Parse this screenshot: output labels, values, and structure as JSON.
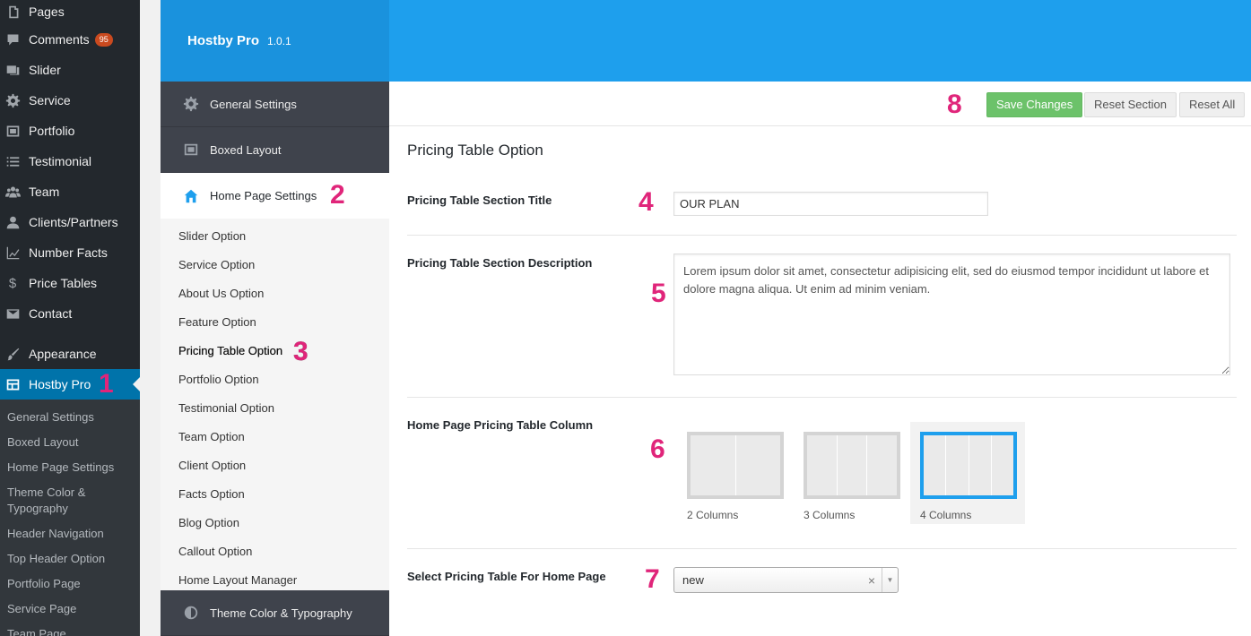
{
  "wp_menu": {
    "items": [
      {
        "label": "Pages",
        "icon": "pages-icon"
      },
      {
        "label": "Comments",
        "icon": "comments-icon",
        "badge": "95"
      },
      {
        "label": "Slider",
        "icon": "slider-icon"
      },
      {
        "label": "Service",
        "icon": "gear-icon"
      },
      {
        "label": "Portfolio",
        "icon": "portfolio-icon"
      },
      {
        "label": "Testimonial",
        "icon": "list-icon"
      },
      {
        "label": "Team",
        "icon": "team-icon"
      },
      {
        "label": "Clients/Partners",
        "icon": "user-icon"
      },
      {
        "label": "Number Facts",
        "icon": "chart-icon"
      },
      {
        "label": "Price Tables",
        "icon": "dollar-icon"
      },
      {
        "label": "Contact",
        "icon": "mail-icon"
      },
      {
        "label": "Appearance",
        "icon": "brush-icon"
      },
      {
        "label": "Hostby Pro",
        "icon": "table-icon",
        "marker": "1"
      }
    ],
    "submenu": [
      "General Settings",
      "Boxed Layout",
      "Home Page Settings",
      "Theme Color & Typography",
      "Header Navigation",
      "Top Header Option",
      "Portfolio Page",
      "Service Page",
      "Team Page"
    ]
  },
  "panel": {
    "brand_name": "Hostby Pro",
    "version": "1.0.1",
    "nav_main": {
      "general": "General Settings",
      "boxed": "Boxed Layout",
      "home": "Home Page Settings",
      "home_marker": "2",
      "theme": "Theme Color & Typography"
    },
    "nav_sub": [
      "Slider Option",
      "Service Option",
      "About Us Option",
      "Feature Option",
      "Pricing Table Option",
      "Portfolio Option",
      "Testimonial Option",
      "Team Option",
      "Client Option",
      "Facts Option",
      "Blog Option",
      "Callout Option",
      "Home Layout Manager"
    ],
    "nav_sub_marker": "3"
  },
  "toolbar": {
    "marker": "8",
    "save": "Save Changes",
    "reset_section": "Reset Section",
    "reset_all": "Reset All"
  },
  "section": {
    "title": "Pricing Table Option",
    "title_field": {
      "label": "Pricing Table Section Title",
      "marker": "4",
      "value": "OUR PLAN"
    },
    "desc_field": {
      "label": "Pricing Table Section Description",
      "marker": "5",
      "value": "Lorem ipsum dolor sit amet, consectetur adipisicing elit, sed do eiusmod tempor incididunt ut labore et dolore magna aliqua. Ut enim ad minim veniam."
    },
    "columns_field": {
      "label": "Home Page Pricing Table Column",
      "marker": "6",
      "options": [
        "2 Columns",
        "3 Columns",
        "4 Columns"
      ],
      "selected": "4 Columns"
    },
    "select_field": {
      "label": "Select Pricing Table For Home Page",
      "marker": "7",
      "value": "new"
    }
  },
  "colors": {
    "accent": "#1e9fed",
    "save_button": "#6cc26a",
    "marker": "#e0257a",
    "wp_active": "#0073aa"
  }
}
